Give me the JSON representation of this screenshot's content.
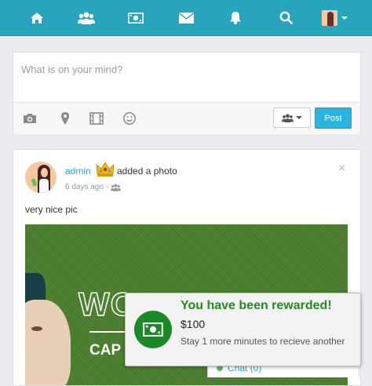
{
  "nav": {
    "items": [
      {
        "icon": "home-icon"
      },
      {
        "icon": "users-icon"
      },
      {
        "icon": "money-icon"
      },
      {
        "icon": "envelope-icon"
      },
      {
        "icon": "bell-icon"
      },
      {
        "icon": "search-icon"
      }
    ],
    "bar_color": "#26a5bd"
  },
  "composer": {
    "placeholder": "What is on your mind?",
    "tools": [
      "camera-icon",
      "map-marker-icon",
      "film-icon",
      "smile-icon"
    ],
    "post_label": "Post"
  },
  "post": {
    "author": "admin",
    "action": "added a photo",
    "time": "6 days ago -",
    "text": "very nice pic",
    "image": {
      "title": "WO",
      "subtitle": "CAP"
    }
  },
  "chat": {
    "label": "Chat (0)"
  },
  "toast": {
    "title": "You have been rewarded!",
    "amount": "$100",
    "message": "Stay 1 more minutes to recieve another",
    "accent": "#228b22"
  }
}
